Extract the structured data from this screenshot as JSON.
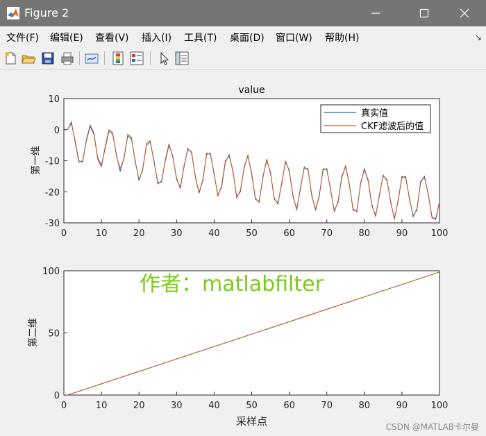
{
  "window": {
    "title": "Figure 2",
    "icons": [
      "matlab-logo-icon",
      "minimize-icon",
      "maximize-icon",
      "close-icon"
    ]
  },
  "menubar": {
    "items": [
      "文件(F)",
      "编辑(E)",
      "查看(V)",
      "插入(I)",
      "工具(T)",
      "桌面(D)",
      "窗口(W)",
      "帮助(H)"
    ],
    "dock_arrow": "↘"
  },
  "toolbar": {
    "icons": [
      "new-figure-icon",
      "open-folder-icon",
      "save-icon",
      "print-icon",
      "link-plot-icon",
      "colorbar-icon",
      "legend-icon",
      "pointer-icon",
      "property-editor-icon"
    ]
  },
  "colors": {
    "series_true": "#0072BD",
    "series_ckf": "#D95319",
    "watermark": "#79cb16"
  },
  "watermark": "作者：matlabfilter",
  "csdn_credit": "CSDN @MATLAB卡尔曼",
  "chart_data": [
    {
      "type": "line",
      "title": "value",
      "xlabel": "",
      "ylabel": "第一维",
      "xlim": [
        0,
        100
      ],
      "ylim": [
        -30,
        10
      ],
      "xticks": [
        "0",
        "10",
        "20",
        "30",
        "40",
        "50",
        "60",
        "70",
        "80",
        "90",
        "100"
      ],
      "yticks": [
        "10",
        "0",
        "-10",
        "-20",
        "-30"
      ],
      "legend": {
        "placement": "top-right",
        "entries": [
          "真实值",
          "CKF滤波后的值"
        ]
      },
      "x": [
        1,
        2,
        3,
        4,
        5,
        6,
        7,
        8,
        9,
        10,
        11,
        12,
        13,
        14,
        15,
        16,
        17,
        18,
        19,
        20,
        21,
        22,
        23,
        24,
        25,
        26,
        27,
        28,
        29,
        30,
        31,
        32,
        33,
        34,
        35,
        36,
        37,
        38,
        39,
        40,
        41,
        42,
        43,
        44,
        45,
        46,
        47,
        48,
        49,
        50,
        51,
        52,
        53,
        54,
        55,
        56,
        57,
        58,
        59,
        60,
        61,
        62,
        63,
        64,
        65,
        66,
        67,
        68,
        69,
        70,
        71,
        72,
        73,
        74,
        75,
        76,
        77,
        78,
        79,
        80,
        81,
        82,
        83,
        84,
        85,
        86,
        87,
        88,
        89,
        90,
        91,
        92,
        93,
        94,
        95,
        96,
        97,
        98,
        99,
        100
      ],
      "series": [
        {
          "name": "真实值",
          "values": [
            0,
            2.5,
            -4,
            -10.5,
            -10,
            -3.5,
            1,
            -1.5,
            -9,
            -11.5,
            -6,
            -0.5,
            -1.5,
            -8,
            -13.5,
            -9,
            -2,
            -3,
            -10,
            -16.5,
            -12.5,
            -5,
            -4,
            -10,
            -17.5,
            -16.5,
            -10,
            -5,
            -8.5,
            -16,
            -18.5,
            -12,
            -6,
            -7.5,
            -15,
            -20.5,
            -16,
            -8,
            -7.5,
            -14.5,
            -21,
            -18.5,
            -10.5,
            -8,
            -13.5,
            -21.5,
            -20,
            -12,
            -8.5,
            -14,
            -22.5,
            -23,
            -15.5,
            -9.5,
            -14,
            -22,
            -24,
            -17,
            -10.5,
            -13,
            -21.5,
            -25.5,
            -19,
            -12,
            -13,
            -21,
            -26,
            -21,
            -13,
            -12.5,
            -19.5,
            -26,
            -23.5,
            -15,
            -12,
            -17.5,
            -26,
            -26,
            -17.5,
            -12.5,
            -16.5,
            -24,
            -28,
            -21,
            -15,
            -16,
            -23.5,
            -28.5,
            -23,
            -15,
            -15.5,
            -22,
            -28,
            -25.5,
            -17,
            -15,
            -21,
            -28,
            -29,
            -23
          ]
        },
        {
          "name": "CKF滤波后的值",
          "values": [
            0,
            2,
            -3.5,
            -10,
            -10.5,
            -3,
            1.5,
            -1,
            -9.5,
            -12,
            -5.5,
            0,
            -1,
            -8.5,
            -12.5,
            -9.5,
            -1.5,
            -2.5,
            -10.5,
            -16,
            -13,
            -4.5,
            -3.5,
            -10.5,
            -17,
            -17,
            -9.5,
            -4.5,
            -9,
            -15.5,
            -19,
            -11.5,
            -6.5,
            -7,
            -15.5,
            -20,
            -16.5,
            -7.5,
            -8,
            -14,
            -21.5,
            -18,
            -10,
            -8.5,
            -13,
            -22,
            -19.5,
            -12.5,
            -8,
            -14.5,
            -22,
            -23.5,
            -15,
            -10,
            -13.5,
            -22.5,
            -23.5,
            -17.5,
            -10,
            -13.5,
            -21,
            -26,
            -18.5,
            -12.5,
            -12.5,
            -21.5,
            -25.5,
            -21.5,
            -12.5,
            -13,
            -19,
            -26.5,
            -23,
            -15.5,
            -11.5,
            -18,
            -25.5,
            -26.5,
            -17,
            -13,
            -16,
            -24.5,
            -27.5,
            -21.5,
            -14.5,
            -16.5,
            -23,
            -29,
            -22.5,
            -15.5,
            -15,
            -22.5,
            -27.5,
            -26,
            -16.5,
            -15.5,
            -20.5,
            -28.5,
            -28.5,
            -23.5
          ]
        }
      ]
    },
    {
      "type": "line",
      "title": "",
      "xlabel": "采样点",
      "ylabel": "第二维",
      "xlim": [
        0,
        100
      ],
      "ylim": [
        0,
        100
      ],
      "xticks": [
        "0",
        "10",
        "20",
        "30",
        "40",
        "50",
        "60",
        "70",
        "80",
        "90",
        "100"
      ],
      "yticks": [
        "100",
        "50",
        "0"
      ],
      "x": [
        1,
        100
      ],
      "series": [
        {
          "name": "真实值",
          "values": [
            0,
            99
          ]
        },
        {
          "name": "CKF滤波后的值",
          "values": [
            0,
            99
          ]
        }
      ]
    }
  ]
}
